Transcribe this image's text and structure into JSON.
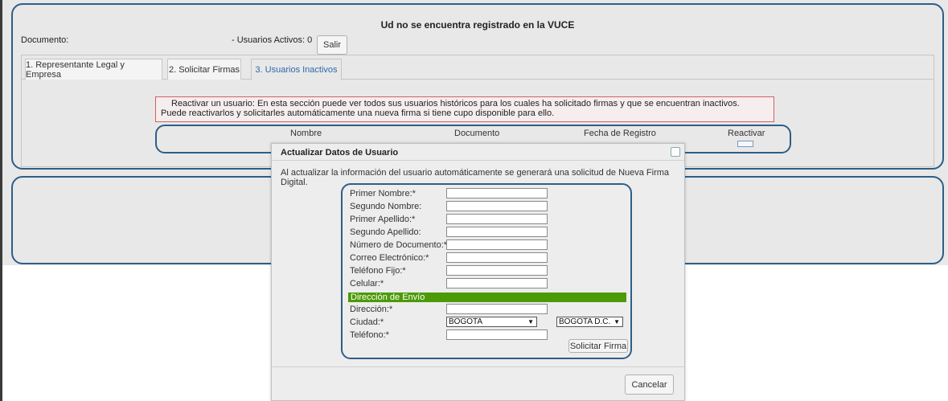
{
  "header": {
    "title": "Ud no se encuentra registrado en la VUCE",
    "document_label": "Documento:",
    "active_users_label": "- Usuarios Activos: 0",
    "exit_button": "Salir"
  },
  "tabs": [
    {
      "label": "1. Representante Legal y Empresa",
      "active": false
    },
    {
      "label": "2. Solicitar Firmas",
      "active": false
    },
    {
      "label": "3. Usuarios Inactivos",
      "active": true
    }
  ],
  "notice": {
    "line1": "Reactivar un usuario: En esta sección puede ver todos sus usuarios históricos para los cuales ha solicitado firmas y que se encuentran inactivos.",
    "line2": "Puede reactivarlos y solicitarles automáticamente una nueva firma si tiene cupo disponible para ello."
  },
  "inactive_table": {
    "columns": [
      "Nombre",
      "Documento",
      "Fecha de Registro",
      "Reactivar"
    ]
  },
  "modal": {
    "title": "Actualizar Datos de Usuario",
    "info": "Al actualizar la información del usuario automáticamente se generará una solicitud de Nueva Firma Digital.",
    "fields": [
      {
        "label": "Primer Nombre:*",
        "value": ""
      },
      {
        "label": "Segundo Nombre:",
        "value": ""
      },
      {
        "label": "Primer Apellido:*",
        "value": ""
      },
      {
        "label": "Segundo Apellido:",
        "value": ""
      },
      {
        "label": "Número de Documento:*",
        "value": ""
      },
      {
        "label": "Correo Electrónico:*",
        "value": ""
      },
      {
        "label": "Teléfono Fijo:*",
        "value": ""
      },
      {
        "label": "Celular:*",
        "value": ""
      }
    ],
    "shipping_section": "Dirección de Envío",
    "address_label": "Dirección:*",
    "city_label": "Ciudad:*",
    "city_value": "BOGOTA",
    "department_value": "BOGOTA D.C.",
    "phone_label": "Teléfono:*",
    "submit_button": "Solicitar Firma",
    "cancel_button": "Cancelar"
  },
  "colors": {
    "panel_border": "#2e5e88",
    "section_bar": "#4c9a08",
    "notice_border": "#d06060",
    "active_tab_text": "#2a6aa8"
  }
}
